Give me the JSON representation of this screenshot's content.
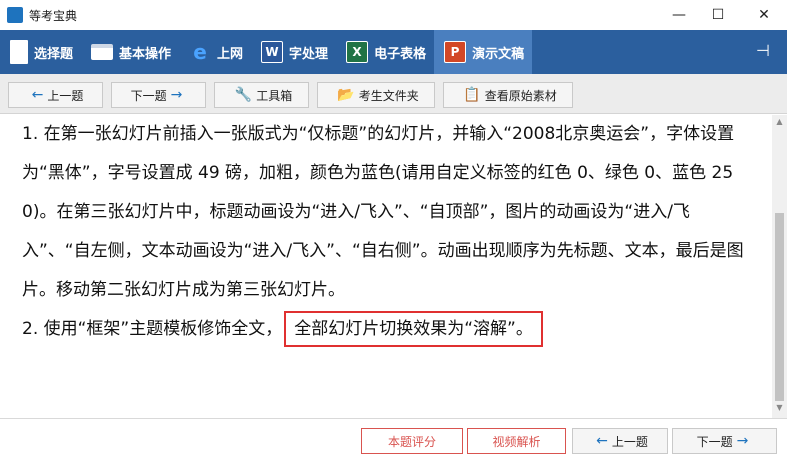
{
  "window": {
    "title": "等考宝典",
    "icon_text": "等考宝典",
    "controls": {
      "minimize": "—",
      "maximize": "☐",
      "close": "✕"
    }
  },
  "main_toolbar": {
    "items": [
      {
        "label": "选择题",
        "icon": "document-icon"
      },
      {
        "label": "基本操作",
        "icon": "window-icon"
      },
      {
        "label": "上网",
        "icon": "ie-icon",
        "glyph": "e"
      },
      {
        "label": "字处理",
        "icon": "word-icon",
        "glyph": "W"
      },
      {
        "label": "电子表格",
        "icon": "excel-icon",
        "glyph": "X"
      },
      {
        "label": "演示文稿",
        "icon": "powerpoint-icon",
        "glyph": "P"
      }
    ],
    "active": "演示文稿",
    "pin_glyph": "⊣"
  },
  "sub_toolbar": {
    "prev": {
      "arrow": "←",
      "label": "上一题"
    },
    "next": {
      "label": "下一题",
      "arrow": "→"
    },
    "tools": {
      "glyph": "🔧",
      "label": "工具箱"
    },
    "folder": {
      "glyph": "📂",
      "label": "考生文件夹"
    },
    "original": {
      "glyph": "📋",
      "label": "查看原始素材"
    }
  },
  "question": {
    "para1": "1. 在第一张幻灯片前插入一张版式为“仅标题”的幻灯片，并输入“2008北京奥运会”，字体设置为“黑体”，字号设置成 49 磅，加粗，颜色为蓝色(请用自定义标签的红色 0、绿色 0、蓝色 250)。在第三张幻灯片中，标题动画设为“进入/飞入”、“自顶部”，图片的动画设为“进入/飞入”、“自左侧，文本动画设为“进入/飞入”、“自右侧”。动画出现顺序为先标题、文本，最后是图片。移动第二张幻灯片成为第三张幻灯片。",
    "para2_lead": "2. 使用“框架”主题模板修饰全文，",
    "para2_highlight": "全部幻灯片切换效果为“溶解”。"
  },
  "bottom_bar": {
    "score": "本题评分",
    "video": "视频解析",
    "prev": {
      "arrow": "←",
      "label": "上一题"
    },
    "next": {
      "label": "下一题",
      "arrow": "→"
    }
  },
  "colors": {
    "toolbar_bg": "#2b5f9e",
    "toolbar_active": "#4a7fbf",
    "accent_red": "#e03030",
    "accent_blue": "#1e73be"
  }
}
